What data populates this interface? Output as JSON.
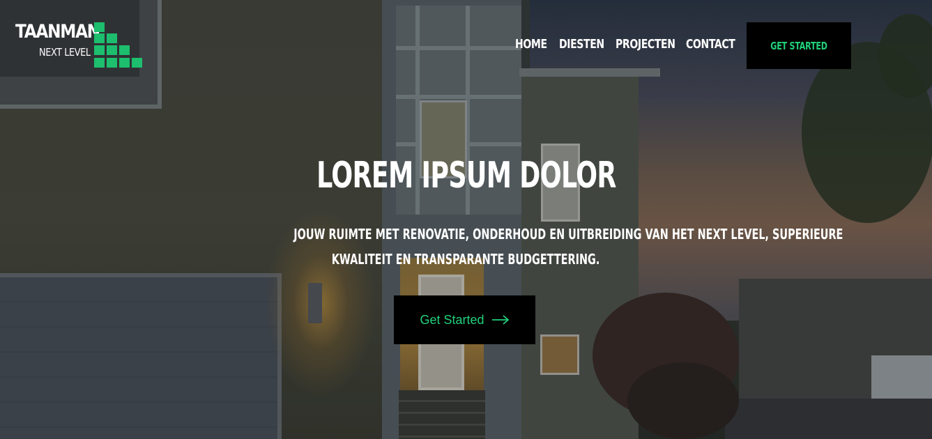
{
  "brand": {
    "name": "TAANMAN",
    "tagline": "NEXT LEVEL",
    "accent_color": "#21d27a"
  },
  "nav": {
    "items": [
      {
        "label": "HOME"
      },
      {
        "label": "DIESTEN"
      },
      {
        "label": "PROJECTEN"
      },
      {
        "label": "CONTACT"
      }
    ],
    "cta_label": "GET STARTED"
  },
  "hero": {
    "title": "LOREM IPSUM DOLOR",
    "subtitle_line1": "JOUW RUIMTE MET RENOVATIE, ONDERHOUD EN UITBREIDING VAN HET NEXT LEVEL, SUPERIEURE",
    "subtitle_line2": "KWALITEIT EN TRANSPARANTE BUDGETTERING.",
    "cta_label": "Get Started",
    "cta_icon": "arrow-right-icon"
  }
}
